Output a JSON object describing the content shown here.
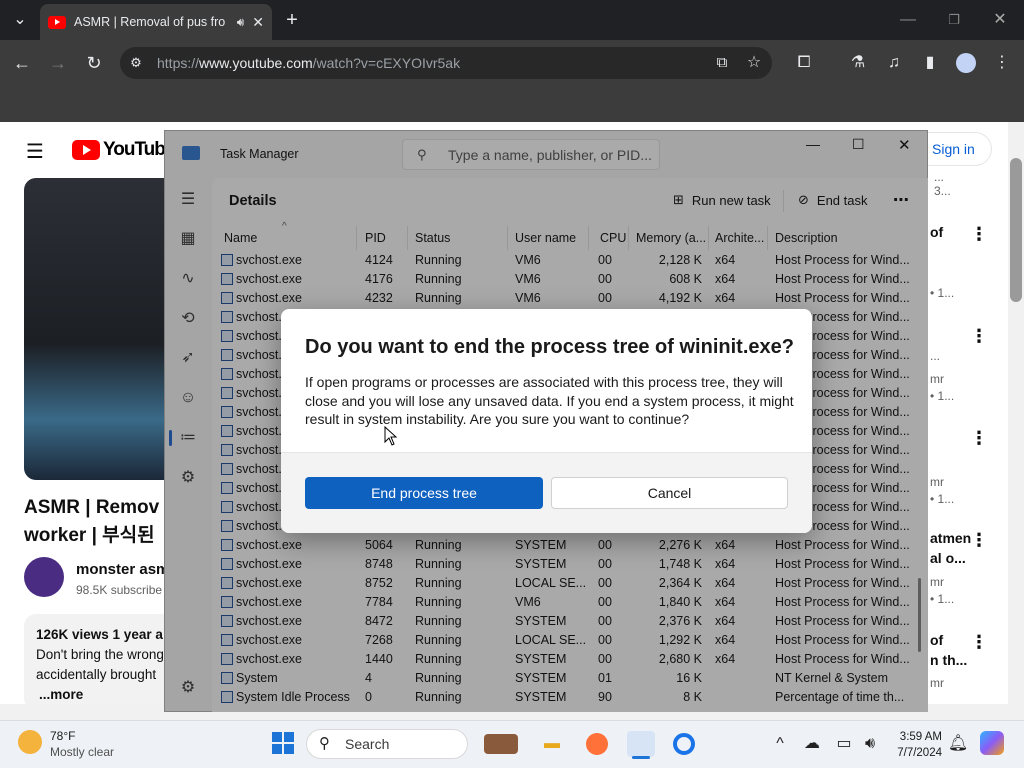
{
  "browser": {
    "tab_title": "ASMR | Removal of pus fro",
    "url_prefix": "https://",
    "url_host": "www.youtube.com",
    "url_path": "/watch?v=cEXYOIvr5ak"
  },
  "youtube": {
    "logo_text": "YouTube",
    "sign_in": "Sign in",
    "video_title_line1": "ASMR | Remov",
    "video_title_line2": "worker | 부식된",
    "channel_name": "monster asm",
    "subscribers": "98.5K subscribe",
    "views": "126K views  1 year a",
    "desc_line1": "Don't bring the wrong",
    "desc_line2": "accidentally brought",
    "more": "...more",
    "right_snippets": [
      "...",
      "3...",
      "of",
      "• 1...",
      "...",
      "mr",
      "• 1...",
      "mr",
      "• 1...",
      "atmen",
      "al o...",
      "mr",
      "• 1...",
      "of",
      "n th...",
      "mr"
    ]
  },
  "taskmanager": {
    "title": "Task Manager",
    "search_placeholder": "Type a name, publisher, or PID...",
    "page": "Details",
    "run_new_task": "Run new task",
    "end_task": "End task",
    "columns": [
      "Name",
      "PID",
      "Status",
      "User name",
      "CPU",
      "Memory (a...",
      "Archite...",
      "Description"
    ],
    "rows": [
      [
        "svchost.exe",
        "4124",
        "Running",
        "VM6",
        "00",
        "2,128 K",
        "x64",
        "Host Process for Wind..."
      ],
      [
        "svchost.exe",
        "4176",
        "Running",
        "VM6",
        "00",
        "608 K",
        "x64",
        "Host Process for Wind..."
      ],
      [
        "svchost.exe",
        "4232",
        "Running",
        "VM6",
        "00",
        "4,192 K",
        "x64",
        "Host Process for Wind..."
      ],
      [
        "svchost.exe",
        "",
        "",
        "",
        "",
        "",
        "",
        "Host Process for Wind..."
      ],
      [
        "svchost.exe",
        "",
        "",
        "",
        "",
        "",
        "",
        "Host Process for Wind..."
      ],
      [
        "svchost.exe",
        "",
        "",
        "",
        "",
        "",
        "",
        "Host Process for Wind..."
      ],
      [
        "svchost.exe",
        "",
        "",
        "",
        "",
        "",
        "",
        "Host Process for Wind..."
      ],
      [
        "svchost.exe",
        "",
        "",
        "",
        "",
        "",
        "",
        "Host Process for Wind..."
      ],
      [
        "svchost.exe",
        "",
        "",
        "",
        "",
        "",
        "",
        "Host Process for Wind..."
      ],
      [
        "svchost.exe",
        "",
        "",
        "",
        "",
        "",
        "",
        "Host Process for Wind..."
      ],
      [
        "svchost.exe",
        "",
        "",
        "",
        "",
        "",
        "",
        "Host Process for Wind..."
      ],
      [
        "svchost.exe",
        "",
        "",
        "",
        "",
        "",
        "",
        "Host Process for Wind..."
      ],
      [
        "svchost.exe",
        "",
        "",
        "",
        "",
        "",
        "",
        "Host Process for Wind..."
      ],
      [
        "svchost.exe",
        "",
        "",
        "",
        "",
        "",
        "",
        "Host Process for Wind..."
      ],
      [
        "svchost.exe",
        "",
        "",
        "",
        "",
        "",
        "",
        "Host Process for Wind..."
      ],
      [
        "svchost.exe",
        "5064",
        "Running",
        "SYSTEM",
        "00",
        "2,276 K",
        "x64",
        "Host Process for Wind..."
      ],
      [
        "svchost.exe",
        "8748",
        "Running",
        "SYSTEM",
        "00",
        "1,748 K",
        "x64",
        "Host Process for Wind..."
      ],
      [
        "svchost.exe",
        "8752",
        "Running",
        "LOCAL SE...",
        "00",
        "2,364 K",
        "x64",
        "Host Process for Wind..."
      ],
      [
        "svchost.exe",
        "7784",
        "Running",
        "VM6",
        "00",
        "1,840 K",
        "x64",
        "Host Process for Wind..."
      ],
      [
        "svchost.exe",
        "8472",
        "Running",
        "SYSTEM",
        "00",
        "2,376 K",
        "x64",
        "Host Process for Wind..."
      ],
      [
        "svchost.exe",
        "7268",
        "Running",
        "LOCAL SE...",
        "00",
        "1,292 K",
        "x64",
        "Host Process for Wind..."
      ],
      [
        "svchost.exe",
        "1440",
        "Running",
        "SYSTEM",
        "00",
        "2,680 K",
        "x64",
        "Host Process for Wind..."
      ],
      [
        "System",
        "4",
        "Running",
        "SYSTEM",
        "01",
        "16 K",
        "",
        "NT Kernel & System"
      ],
      [
        "System Idle Process",
        "0",
        "Running",
        "SYSTEM",
        "90",
        "8 K",
        "",
        "Percentage of time th..."
      ]
    ]
  },
  "dialog": {
    "title": "Do you want to end the process tree of wininit.exe?",
    "body": "If open programs or processes are associated with this process tree, they will close and you will lose any unsaved data. If you end a system process, it might result in system instability. Are you sure you want to continue?",
    "confirm": "End process tree",
    "cancel": "Cancel"
  },
  "taskbar": {
    "temperature": "78°F",
    "weather": "Mostly clear",
    "search": "Search",
    "time": "3:59 AM",
    "date": "7/7/2024"
  }
}
